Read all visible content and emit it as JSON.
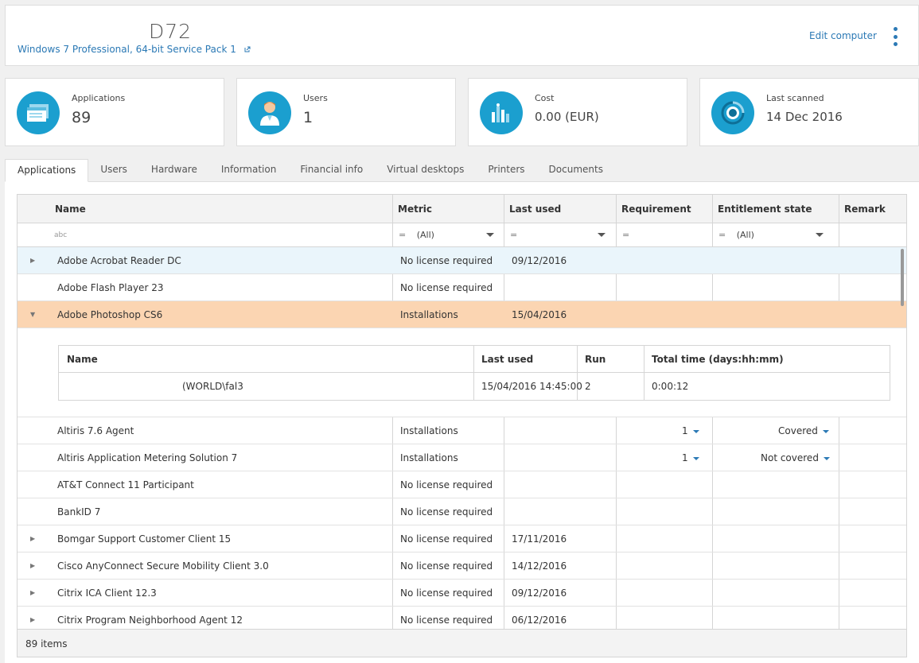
{
  "header": {
    "computer_name": "D72",
    "os": "Windows 7 Professional, 64-bit Service Pack 1",
    "edit_label": "Edit computer"
  },
  "cards": [
    {
      "label": "Applications",
      "value": "89",
      "icon": "applications-icon"
    },
    {
      "label": "Users",
      "value": "1",
      "icon": "user-icon"
    },
    {
      "label": "Cost",
      "value": "0.00 (EUR)",
      "icon": "cost-chart-icon"
    },
    {
      "label": "Last scanned",
      "value": "14 Dec 2016",
      "icon": "scan-icon"
    }
  ],
  "tabs": [
    "Applications",
    "Users",
    "Hardware",
    "Information",
    "Financial info",
    "Virtual desktops",
    "Printers",
    "Documents"
  ],
  "grid": {
    "columns": [
      "Name",
      "Metric",
      "Last used",
      "Requirement",
      "Entitlement state",
      "Remark"
    ],
    "filter": {
      "name_placeholder": "abc",
      "metric": "(All)",
      "entitlement": "(All)",
      "eq": "="
    },
    "rows": [
      {
        "name": "Adobe Acrobat Reader DC",
        "metric": "No license required",
        "last_used": "09/12/2016",
        "requirement": "",
        "entitlement": ""
      },
      {
        "name": "Adobe Flash Player 23",
        "metric": "No license required",
        "last_used": "",
        "requirement": "",
        "entitlement": ""
      },
      {
        "name": "Adobe Photoshop CS6",
        "metric": "Installations",
        "last_used": "15/04/2016",
        "requirement": "",
        "entitlement": ""
      },
      {
        "name": "Altiris 7.6 Agent",
        "metric": "Installations",
        "last_used": "",
        "requirement": "1",
        "entitlement": "Covered"
      },
      {
        "name": "Altiris Application Metering Solution 7",
        "metric": "Installations",
        "last_used": "",
        "requirement": "1",
        "entitlement": "Not covered"
      },
      {
        "name": "AT&T Connect 11 Participant",
        "metric": "No license required",
        "last_used": "",
        "requirement": "",
        "entitlement": ""
      },
      {
        "name": "BankID 7",
        "metric": "No license required",
        "last_used": "",
        "requirement": "",
        "entitlement": ""
      },
      {
        "name": "Bomgar Support Customer Client 15",
        "metric": "No license required",
        "last_used": "17/11/2016",
        "requirement": "",
        "entitlement": ""
      },
      {
        "name": "Cisco AnyConnect Secure Mobility Client 3.0",
        "metric": "No license required",
        "last_used": "14/12/2016",
        "requirement": "",
        "entitlement": ""
      },
      {
        "name": "Citrix ICA Client 12.3",
        "metric": "No license required",
        "last_used": "09/12/2016",
        "requirement": "",
        "entitlement": ""
      },
      {
        "name": "Citrix Program Neighborhood Agent 12",
        "metric": "No license required",
        "last_used": "06/12/2016",
        "requirement": "",
        "entitlement": ""
      }
    ],
    "detail": {
      "columns": [
        "Name",
        "Last used",
        "Run",
        "Total time (days:hh:mm)"
      ],
      "row": {
        "name": "(WORLD\\fal3",
        "last_used": "15/04/2016 14:45:00",
        "run": "2",
        "total": "0:00:12"
      }
    },
    "footer": "89 items"
  }
}
